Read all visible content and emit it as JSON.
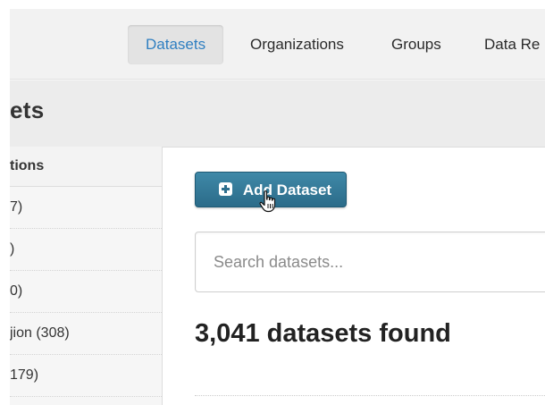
{
  "nav": {
    "items": [
      {
        "label": "Datasets",
        "active": true
      },
      {
        "label": "Organizations",
        "active": false
      },
      {
        "label": "Groups",
        "active": false
      },
      {
        "label": "Data Re",
        "active": false
      }
    ]
  },
  "page": {
    "title": "ets"
  },
  "sidebar": {
    "heading": "tions",
    "items": [
      {
        "label": "7)"
      },
      {
        "label": ")"
      },
      {
        "label": "0)"
      },
      {
        "label": "jion (308)"
      },
      {
        "label": "179)"
      }
    ]
  },
  "main": {
    "add_button_label": "Add Dataset",
    "search_placeholder": "Search datasets...",
    "search_value": "",
    "results_text": "3,041 datasets found"
  },
  "icons": {
    "add": "plus-square-icon",
    "cursor": "hand-pointer-icon"
  },
  "colors": {
    "accent": "#2f7fc1",
    "button": "#2b6b89"
  }
}
